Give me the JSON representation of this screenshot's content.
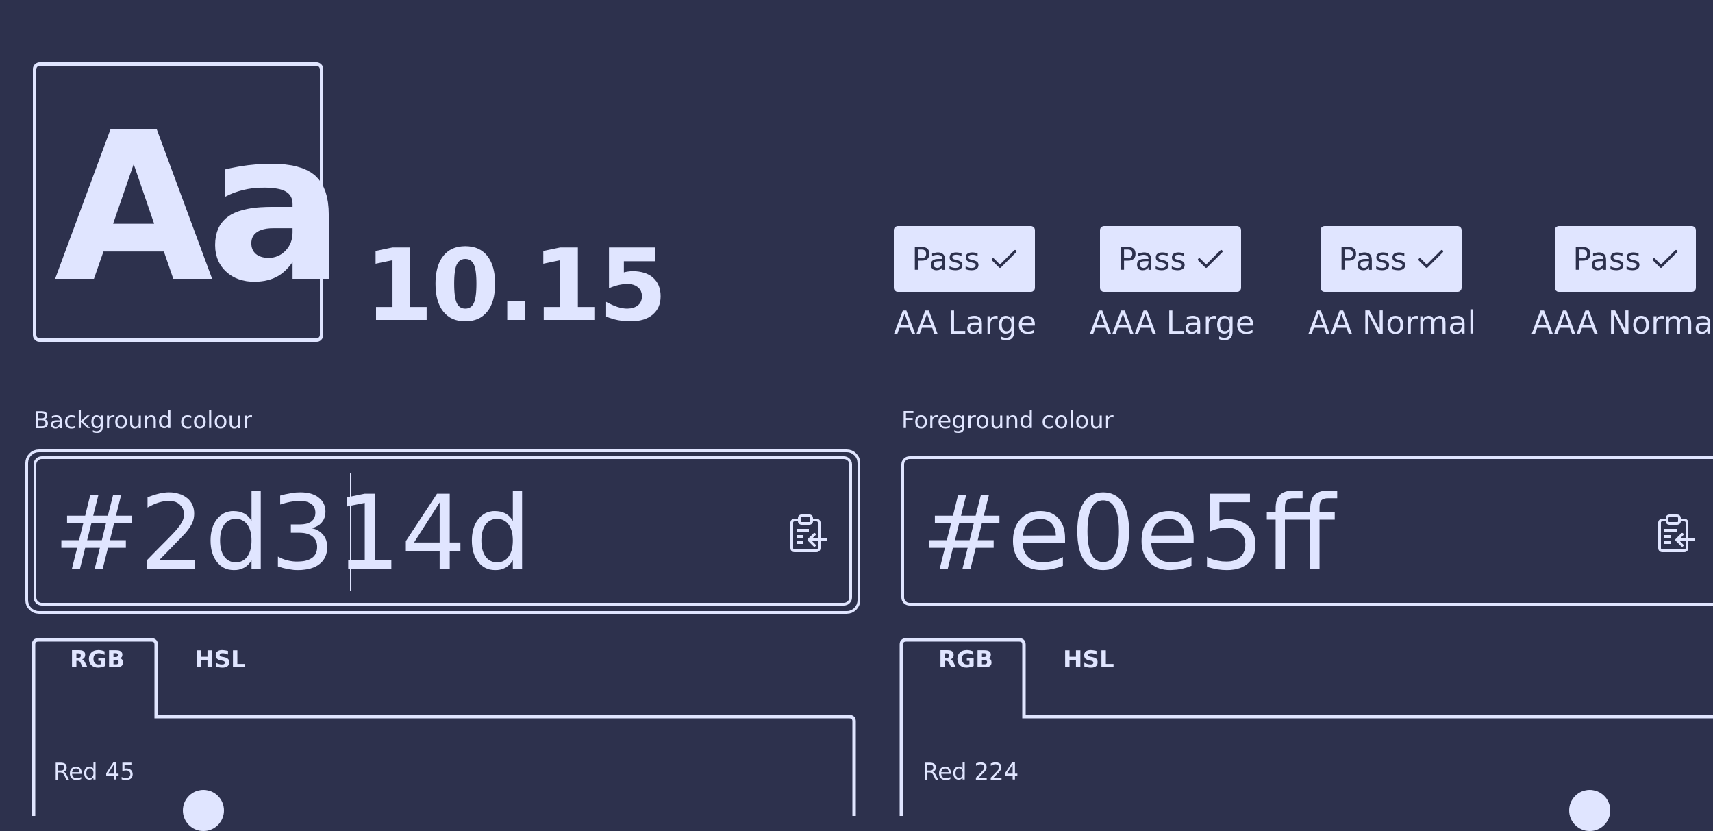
{
  "preview": {
    "sample": "Aa",
    "ratio": "10.15"
  },
  "results": [
    {
      "badge": "Pass",
      "icon": "check-icon",
      "label": "AA Large"
    },
    {
      "badge": "Pass",
      "icon": "check-icon",
      "label": "AAA Large"
    },
    {
      "badge": "Pass",
      "icon": "check-icon",
      "label": "AA Normal"
    },
    {
      "badge": "Pass",
      "icon": "check-icon",
      "label": "AAA Normal"
    }
  ],
  "background": {
    "label": "Background colour",
    "value": "#2d314d",
    "paste_icon": "paste-icon",
    "tabs": [
      "RGB",
      "HSL"
    ],
    "active_tab": "RGB",
    "channel_label": "Red 45",
    "channel_value": 45
  },
  "foreground": {
    "label": "Foreground colour",
    "value": "#e0e5ff",
    "paste_icon": "paste-icon",
    "tabs": [
      "RGB",
      "HSL"
    ],
    "active_tab": "RGB",
    "channel_label": "Red 224",
    "channel_value": 224
  },
  "colors": {
    "background": "#2d314d",
    "foreground": "#e0e5ff"
  }
}
